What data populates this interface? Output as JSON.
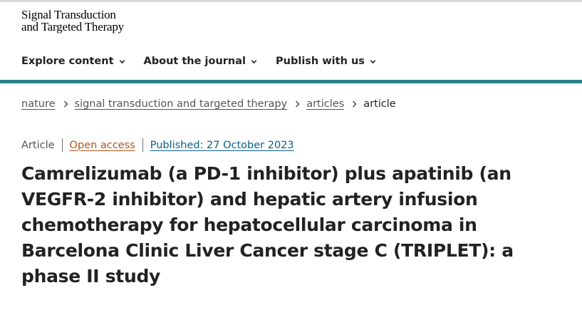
{
  "logo": {
    "line1": "Signal Transduction",
    "line2": "and Targeted Therapy"
  },
  "nav": {
    "items": [
      {
        "label": "Explore content",
        "icon": "chevron-down-icon"
      },
      {
        "label": "About the journal",
        "icon": "chevron-down-icon"
      },
      {
        "label": "Publish with us",
        "icon": "chevron-down-icon"
      }
    ]
  },
  "breadcrumb": {
    "items": [
      "nature",
      "signal transduction and targeted therapy",
      "articles"
    ],
    "current": "article"
  },
  "meta": {
    "type": "Article",
    "access": "Open access",
    "published": "Published: 27 October 2023"
  },
  "article": {
    "title": "Camrelizumab (a PD-1 inhibitor) plus apatinib (an VEGFR-2 inhibitor) and hepatic artery infusion chemotherapy for hepatocellular carcinoma in Barcelona Clinic Liver Cancer stage C (TRIPLET): a phase II study"
  },
  "colors": {
    "accent_bar": "#267f8c",
    "open_access": "#b3531c",
    "published_link": "#0b5d8a"
  }
}
